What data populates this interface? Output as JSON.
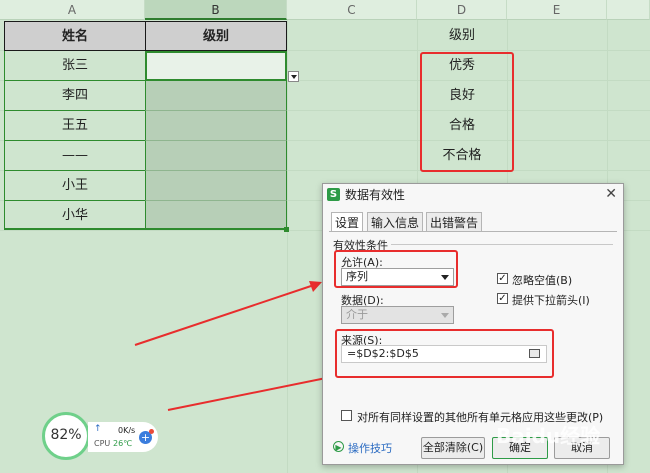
{
  "columns": [
    "A",
    "B",
    "C",
    "D",
    "E"
  ],
  "table": {
    "headers": [
      "姓名",
      "级别"
    ],
    "names": [
      "张三",
      "李四",
      "王五",
      "——",
      "小王",
      "小华"
    ]
  },
  "list": {
    "header": "级别",
    "items": [
      "优秀",
      "良好",
      "合格",
      "不合格"
    ]
  },
  "dialog": {
    "title": "数据有效性",
    "tabs": [
      "设置",
      "输入信息",
      "出错警告"
    ],
    "group_label": "有效性条件",
    "allow_label": "允许(A):",
    "allow_value": "序列",
    "data_label": "数据(D):",
    "data_value": "介于",
    "ignore_blank": "忽略空值(B)",
    "dropdown_arrow": "提供下拉箭头(I)",
    "source_label": "来源(S):",
    "source_value": "=$D$2:$D$5",
    "apply_all": "对所有同样设置的其他所有单元格应用这些更改(P)",
    "tips_link": "操作技巧",
    "clear_all": "全部清除(C)",
    "ok": "确定",
    "cancel": "取消"
  },
  "widget": {
    "percent": "82%",
    "speed": "0K/s",
    "cpu_label": "CPU",
    "cpu_temp": "26℃"
  },
  "watermark": "Baidu经验",
  "colors": {
    "accent_red": "#e82d2d",
    "grid_green": "#cfe5cf",
    "selection": "#2e8b2e"
  }
}
